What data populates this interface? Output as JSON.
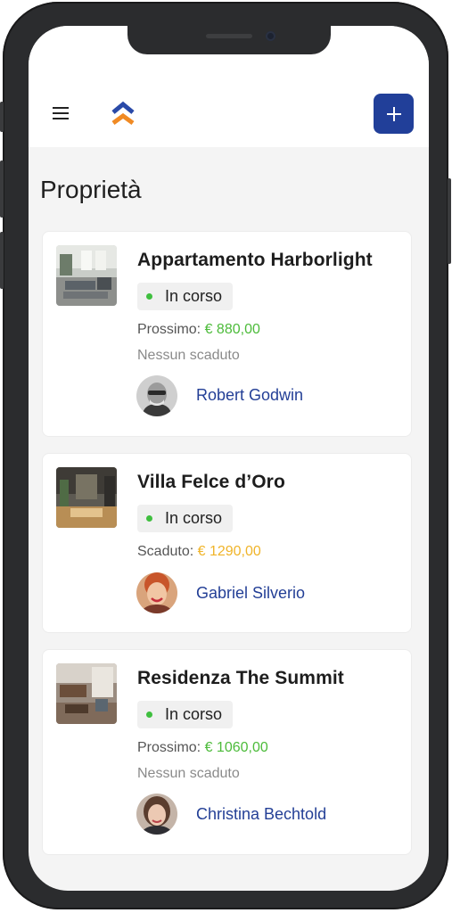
{
  "header": {
    "menu_icon": "hamburger-menu-icon",
    "logo_icon": "house-chevron-logo-icon",
    "add_icon": "plus-icon",
    "brand_colors": {
      "primary": "#213f99",
      "logo_blue": "#2a4aa8",
      "logo_orange": "#f08a24"
    }
  },
  "page": {
    "title": "Proprietà"
  },
  "properties": [
    {
      "name": "Appartamento Harborlight",
      "status": "In corso",
      "due_label": "Prossimo:",
      "due_amount": "€ 880,00",
      "overdue_text": "Nessun scaduto",
      "owner": "Robert Godwin"
    },
    {
      "name": "Villa Felce d’Oro",
      "status": "In corso",
      "due_label": "Scaduto:",
      "due_amount": "€ 1290,00",
      "owner": "Gabriel Silverio"
    },
    {
      "name": "Residenza The Summit",
      "status": "In corso",
      "due_label": "Prossimo:",
      "due_amount": "€ 1060,00",
      "overdue_text": "Nessun scaduto",
      "owner": "Christina Bechtold"
    }
  ],
  "colors": {
    "status_active": "#3fbf3f",
    "amount_upcoming": "#4cbb3a",
    "amount_overdue": "#f0b429",
    "owner_link": "#233f96"
  }
}
